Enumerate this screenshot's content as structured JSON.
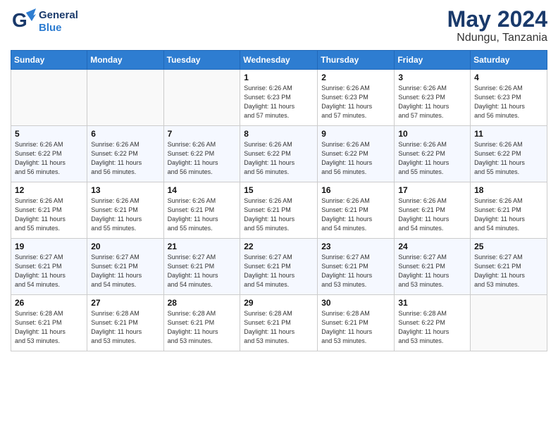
{
  "logo": {
    "line1": "General",
    "line2": "Blue"
  },
  "title": {
    "month_year": "May 2024",
    "location": "Ndungu, Tanzania"
  },
  "weekdays": [
    "Sunday",
    "Monday",
    "Tuesday",
    "Wednesday",
    "Thursday",
    "Friday",
    "Saturday"
  ],
  "weeks": [
    [
      {
        "day": "",
        "info": ""
      },
      {
        "day": "",
        "info": ""
      },
      {
        "day": "",
        "info": ""
      },
      {
        "day": "1",
        "info": "Sunrise: 6:26 AM\nSunset: 6:23 PM\nDaylight: 11 hours\nand 57 minutes."
      },
      {
        "day": "2",
        "info": "Sunrise: 6:26 AM\nSunset: 6:23 PM\nDaylight: 11 hours\nand 57 minutes."
      },
      {
        "day": "3",
        "info": "Sunrise: 6:26 AM\nSunset: 6:23 PM\nDaylight: 11 hours\nand 57 minutes."
      },
      {
        "day": "4",
        "info": "Sunrise: 6:26 AM\nSunset: 6:23 PM\nDaylight: 11 hours\nand 56 minutes."
      }
    ],
    [
      {
        "day": "5",
        "info": "Sunrise: 6:26 AM\nSunset: 6:22 PM\nDaylight: 11 hours\nand 56 minutes."
      },
      {
        "day": "6",
        "info": "Sunrise: 6:26 AM\nSunset: 6:22 PM\nDaylight: 11 hours\nand 56 minutes."
      },
      {
        "day": "7",
        "info": "Sunrise: 6:26 AM\nSunset: 6:22 PM\nDaylight: 11 hours\nand 56 minutes."
      },
      {
        "day": "8",
        "info": "Sunrise: 6:26 AM\nSunset: 6:22 PM\nDaylight: 11 hours\nand 56 minutes."
      },
      {
        "day": "9",
        "info": "Sunrise: 6:26 AM\nSunset: 6:22 PM\nDaylight: 11 hours\nand 56 minutes."
      },
      {
        "day": "10",
        "info": "Sunrise: 6:26 AM\nSunset: 6:22 PM\nDaylight: 11 hours\nand 55 minutes."
      },
      {
        "day": "11",
        "info": "Sunrise: 6:26 AM\nSunset: 6:22 PM\nDaylight: 11 hours\nand 55 minutes."
      }
    ],
    [
      {
        "day": "12",
        "info": "Sunrise: 6:26 AM\nSunset: 6:21 PM\nDaylight: 11 hours\nand 55 minutes."
      },
      {
        "day": "13",
        "info": "Sunrise: 6:26 AM\nSunset: 6:21 PM\nDaylight: 11 hours\nand 55 minutes."
      },
      {
        "day": "14",
        "info": "Sunrise: 6:26 AM\nSunset: 6:21 PM\nDaylight: 11 hours\nand 55 minutes."
      },
      {
        "day": "15",
        "info": "Sunrise: 6:26 AM\nSunset: 6:21 PM\nDaylight: 11 hours\nand 55 minutes."
      },
      {
        "day": "16",
        "info": "Sunrise: 6:26 AM\nSunset: 6:21 PM\nDaylight: 11 hours\nand 54 minutes."
      },
      {
        "day": "17",
        "info": "Sunrise: 6:26 AM\nSunset: 6:21 PM\nDaylight: 11 hours\nand 54 minutes."
      },
      {
        "day": "18",
        "info": "Sunrise: 6:26 AM\nSunset: 6:21 PM\nDaylight: 11 hours\nand 54 minutes."
      }
    ],
    [
      {
        "day": "19",
        "info": "Sunrise: 6:27 AM\nSunset: 6:21 PM\nDaylight: 11 hours\nand 54 minutes."
      },
      {
        "day": "20",
        "info": "Sunrise: 6:27 AM\nSunset: 6:21 PM\nDaylight: 11 hours\nand 54 minutes."
      },
      {
        "day": "21",
        "info": "Sunrise: 6:27 AM\nSunset: 6:21 PM\nDaylight: 11 hours\nand 54 minutes."
      },
      {
        "day": "22",
        "info": "Sunrise: 6:27 AM\nSunset: 6:21 PM\nDaylight: 11 hours\nand 54 minutes."
      },
      {
        "day": "23",
        "info": "Sunrise: 6:27 AM\nSunset: 6:21 PM\nDaylight: 11 hours\nand 53 minutes."
      },
      {
        "day": "24",
        "info": "Sunrise: 6:27 AM\nSunset: 6:21 PM\nDaylight: 11 hours\nand 53 minutes."
      },
      {
        "day": "25",
        "info": "Sunrise: 6:27 AM\nSunset: 6:21 PM\nDaylight: 11 hours\nand 53 minutes."
      }
    ],
    [
      {
        "day": "26",
        "info": "Sunrise: 6:28 AM\nSunset: 6:21 PM\nDaylight: 11 hours\nand 53 minutes."
      },
      {
        "day": "27",
        "info": "Sunrise: 6:28 AM\nSunset: 6:21 PM\nDaylight: 11 hours\nand 53 minutes."
      },
      {
        "day": "28",
        "info": "Sunrise: 6:28 AM\nSunset: 6:21 PM\nDaylight: 11 hours\nand 53 minutes."
      },
      {
        "day": "29",
        "info": "Sunrise: 6:28 AM\nSunset: 6:21 PM\nDaylight: 11 hours\nand 53 minutes."
      },
      {
        "day": "30",
        "info": "Sunrise: 6:28 AM\nSunset: 6:21 PM\nDaylight: 11 hours\nand 53 minutes."
      },
      {
        "day": "31",
        "info": "Sunrise: 6:28 AM\nSunset: 6:22 PM\nDaylight: 11 hours\nand 53 minutes."
      },
      {
        "day": "",
        "info": ""
      }
    ]
  ]
}
